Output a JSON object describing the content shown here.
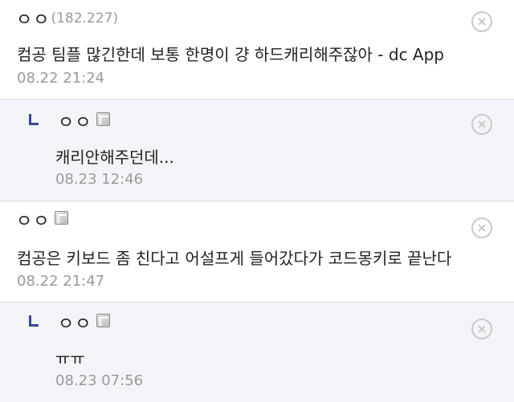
{
  "comments": [
    {
      "nickname": "ㅇㅇ",
      "ip": "(182.227)",
      "text": "컴공 팀플 많긴한데 보통 한명이 걍 하드캐리해주잖아 - dc App",
      "date": "08.22 21:24",
      "is_reply": false
    },
    {
      "nickname": "ㅇㅇ",
      "text": "캐리안해주던데...",
      "date": "08.23 12:46",
      "is_reply": true
    },
    {
      "nickname": "ㅇㅇ",
      "text": "컴공은 키보드 좀 친다고 어설프게 들어갔다가 코드몽키로 끝난다",
      "date": "08.22 21:47",
      "is_reply": false
    },
    {
      "nickname": "ㅇㅇ",
      "text": "ㅠㅠ",
      "date": "08.23 07:56",
      "is_reply": true
    }
  ],
  "colors": {
    "reply_background": "#f3f4f7",
    "reply_arrow": "#3b4890",
    "date_text": "#9a9a9a",
    "divider": "#dcdde3"
  },
  "icons": {
    "delete": "circle-x-icon",
    "gonick": "gonick-badge-icon",
    "reply": "reply-arrow-icon"
  }
}
